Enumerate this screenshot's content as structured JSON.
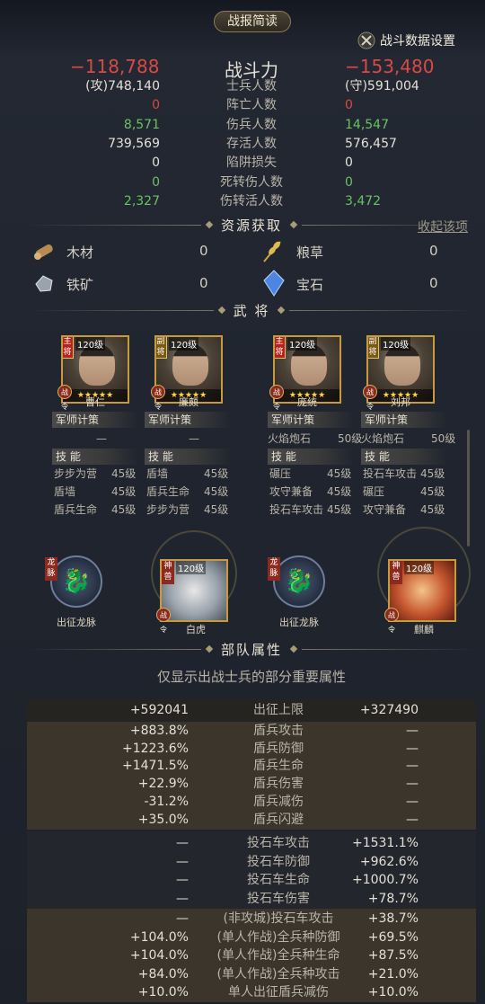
{
  "header": {
    "title": "战报简读",
    "settings": "战斗数据设置"
  },
  "combat": {
    "power_label": "战斗力",
    "attacker_power": "−118,788",
    "defender_power": "−153,480",
    "rows": [
      {
        "left": "(攻)748,140",
        "label": "士兵人数",
        "right": "(守)591,004",
        "lc": "white",
        "rc": "white"
      },
      {
        "left": "0",
        "label": "阵亡人数",
        "right": "0",
        "lc": "red",
        "rc": "red"
      },
      {
        "left": "8,571",
        "label": "伤兵人数",
        "right": "14,547",
        "lc": "green",
        "rc": "green"
      },
      {
        "left": "739,569",
        "label": "存活人数",
        "right": "576,457",
        "lc": "white",
        "rc": "white"
      },
      {
        "left": "0",
        "label": "陷阱损失",
        "right": "0",
        "lc": "white",
        "rc": "white"
      },
      {
        "left": "0",
        "label": "死转伤人数",
        "right": "0",
        "lc": "green",
        "rc": "green"
      },
      {
        "left": "2,327",
        "label": "伤转活人数",
        "right": "3,472",
        "lc": "green",
        "rc": "green"
      }
    ]
  },
  "resources": {
    "title": "资源获取",
    "collapse": "收起该项",
    "items": [
      {
        "name": "木材",
        "value": "0",
        "icon": "wood-icon"
      },
      {
        "name": "粮草",
        "value": "0",
        "icon": "grain-icon"
      },
      {
        "name": "铁矿",
        "value": "0",
        "icon": "iron-icon"
      },
      {
        "name": "宝石",
        "value": "0",
        "icon": "gem-icon"
      }
    ]
  },
  "generals": {
    "title": "武 将",
    "cards": [
      {
        "name": "曹仁",
        "level": "120级",
        "role": "主将",
        "stars": "★★★★★",
        "strategy_label": "军师计策",
        "strategy": [
          "—",
          ""
        ],
        "skills_label": "技 能",
        "skills": [
          [
            "步步为营",
            "45级"
          ],
          [
            "盾墙",
            "45级"
          ],
          [
            "盾兵生命",
            "45级"
          ]
        ]
      },
      {
        "name": "廉颇",
        "level": "120级",
        "role": "副将",
        "stars": "★★★★★",
        "strategy_label": "军师计策",
        "strategy": [
          "—",
          ""
        ],
        "skills_label": "技 能",
        "skills": [
          [
            "盾墙",
            "45级"
          ],
          [
            "盾兵生命",
            "45级"
          ],
          [
            "步步为营",
            "45级"
          ]
        ]
      },
      {
        "name": "庞统",
        "level": "120级",
        "role": "主将",
        "stars": "★★★★★",
        "strategy_label": "军师计策",
        "strategy": [
          "火焰炮石",
          "50级"
        ],
        "skills_label": "技 能",
        "skills": [
          [
            "碾压",
            "45级"
          ],
          [
            "攻守兼备",
            "45级"
          ],
          [
            "投石车攻击",
            "45级"
          ]
        ]
      },
      {
        "name": "刘邦",
        "level": "120级",
        "role": "副将",
        "stars": "★★★★★",
        "strategy_label": "军师计策",
        "strategy": [
          "火焰炮石",
          "50级"
        ],
        "skills_label": "技 能",
        "skills": [
          [
            "投石车攻击",
            "45级"
          ],
          [
            "碾压",
            "45级"
          ],
          [
            "攻守兼备",
            "45级"
          ]
        ]
      }
    ],
    "badge_text": "战令",
    "pets": [
      {
        "label": "出征龙脉",
        "tag": "龙脉"
      },
      {
        "label": "白虎",
        "tag": "神兽",
        "level": "120级"
      },
      {
        "label": "出征龙脉",
        "tag": "龙脉"
      },
      {
        "label": "麒麟",
        "tag": "神兽",
        "level": "120级"
      }
    ]
  },
  "troops": {
    "title": "部队属性",
    "subtitle": "仅显示出战士兵的部分重要属性",
    "rows": [
      {
        "left": "+592041",
        "label": "出征上限",
        "right": "+327490"
      },
      {
        "left": "+883.8%",
        "label": "盾兵攻击",
        "right": "—"
      },
      {
        "left": "+1223.6%",
        "label": "盾兵防御",
        "right": "—"
      },
      {
        "left": "+1471.5%",
        "label": "盾兵生命",
        "right": "—"
      },
      {
        "left": "+22.9%",
        "label": "盾兵伤害",
        "right": "—"
      },
      {
        "left": "-31.2%",
        "label": "盾兵减伤",
        "right": "—"
      },
      {
        "left": "+35.0%",
        "label": "盾兵闪避",
        "right": "—"
      },
      {
        "left": "—",
        "label": "投石车攻击",
        "right": "+1531.1%"
      },
      {
        "left": "—",
        "label": "投石车防御",
        "right": "+962.6%"
      },
      {
        "left": "—",
        "label": "投石车生命",
        "right": "+1000.7%"
      },
      {
        "left": "—",
        "label": "投石车伤害",
        "right": "+78.7%"
      },
      {
        "left": "—",
        "label": "(非攻城)投石车攻击",
        "right": "+38.7%"
      },
      {
        "left": "+104.0%",
        "label": "(单人作战)全兵种防御",
        "right": "+69.5%"
      },
      {
        "left": "+104.0%",
        "label": "(单人作战)全兵种生命",
        "right": "+87.5%"
      },
      {
        "left": "+84.0%",
        "label": "(单人作战)全兵种攻击",
        "right": "+21.0%"
      },
      {
        "left": "+10.0%",
        "label": "单人出征盾兵减伤",
        "right": "+10.0%"
      }
    ]
  }
}
